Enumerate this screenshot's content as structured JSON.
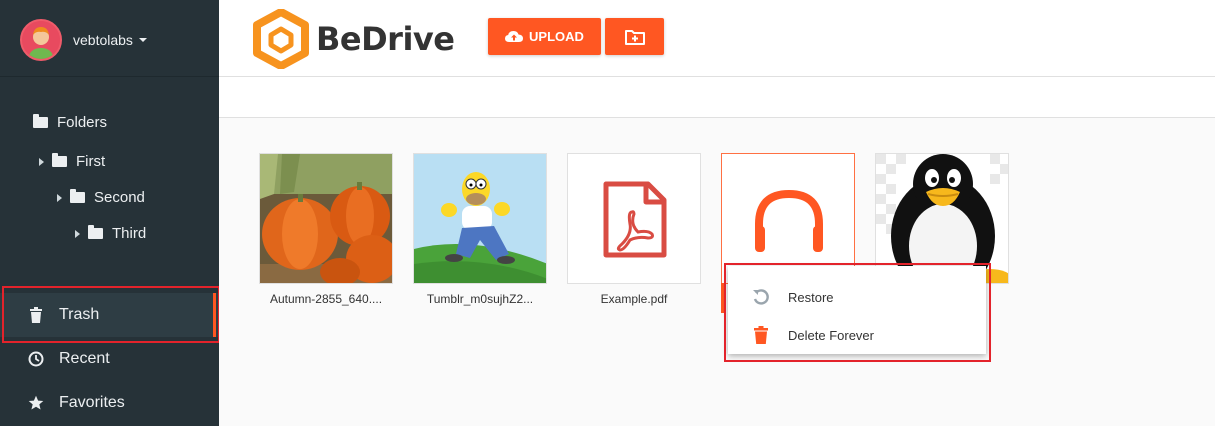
{
  "user": {
    "name": "vebtolabs"
  },
  "header": {
    "brand": "BeDrive",
    "upload_label": "UPLOAD"
  },
  "sidebar": {
    "folders": [
      {
        "label": "Folders"
      },
      {
        "label": "First"
      },
      {
        "label": "Second"
      },
      {
        "label": "Third"
      }
    ],
    "nav": [
      {
        "label": "Trash",
        "icon": "trash-icon"
      },
      {
        "label": "Recent",
        "icon": "clock-icon"
      },
      {
        "label": "Favorites",
        "icon": "star-icon"
      }
    ]
  },
  "files": [
    {
      "name": "Autumn-2855_640....",
      "kind": "image-pumpkins"
    },
    {
      "name": "Tumblr_m0sujhZ2...",
      "kind": "image-homer"
    },
    {
      "name": "Example.pdf",
      "kind": "pdf"
    },
    {
      "name": "",
      "kind": "audio"
    },
    {
      "name": "",
      "kind": "image-tux"
    }
  ],
  "context_menu": {
    "items": [
      {
        "label": "Restore",
        "icon": "restore-icon"
      },
      {
        "label": "Delete Forever",
        "icon": "delete-icon"
      }
    ]
  },
  "colors": {
    "accent": "#ff5722",
    "sidebar": "#263238",
    "highlight": "#e3232b"
  }
}
